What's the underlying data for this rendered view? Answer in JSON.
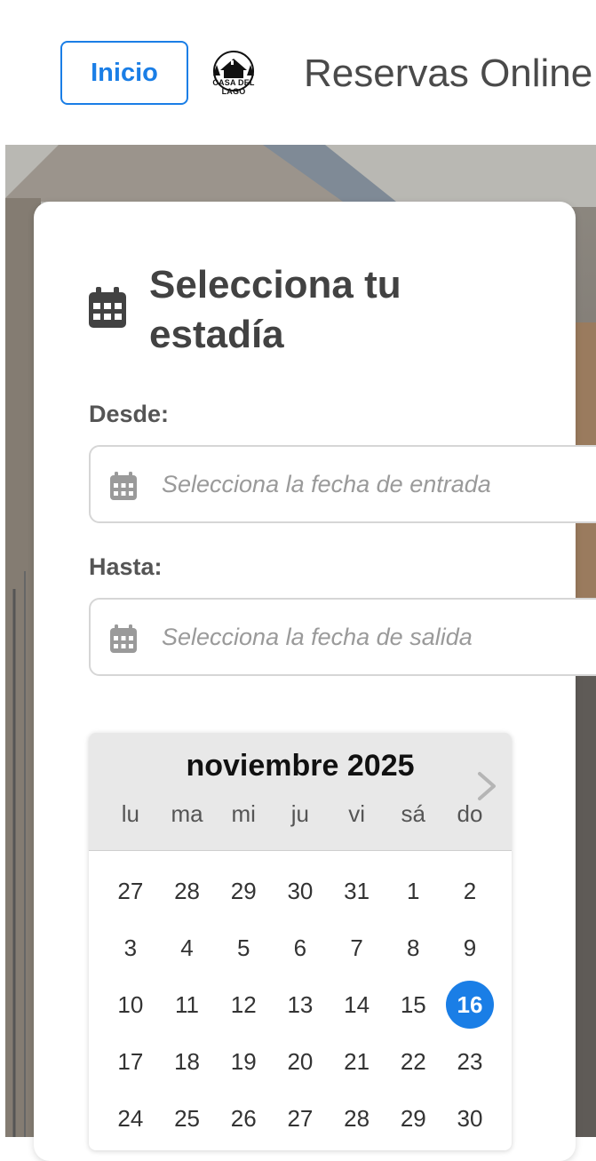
{
  "header": {
    "home_label": "Inicio",
    "logo_text": "CASA DEL LAGO",
    "site_title": "Reservas Online"
  },
  "stay_form": {
    "title": "Selecciona tu estadía",
    "from_label": "Desde:",
    "from_placeholder": "Selecciona la fecha de entrada",
    "to_label": "Hasta:",
    "to_placeholder": "Selecciona la fecha de salida"
  },
  "calendar": {
    "month_label": "noviembre 2025",
    "weekdays": [
      "lu",
      "ma",
      "mi",
      "ju",
      "vi",
      "sá",
      "do"
    ],
    "weeks": [
      [
        "27",
        "28",
        "29",
        "30",
        "31",
        "1",
        "2"
      ],
      [
        "3",
        "4",
        "5",
        "6",
        "7",
        "8",
        "9"
      ],
      [
        "10",
        "11",
        "12",
        "13",
        "14",
        "15",
        "16"
      ],
      [
        "17",
        "18",
        "19",
        "20",
        "21",
        "22",
        "23"
      ],
      [
        "24",
        "25",
        "26",
        "27",
        "28",
        "29",
        "30"
      ]
    ],
    "selected_day": "16"
  },
  "icons": {
    "calendar": "calendar-icon",
    "next_month": "chevron-right-icon"
  },
  "colors": {
    "accent": "#1a7ee6",
    "title_text": "#424242",
    "placeholder": "#9a9a9a"
  }
}
